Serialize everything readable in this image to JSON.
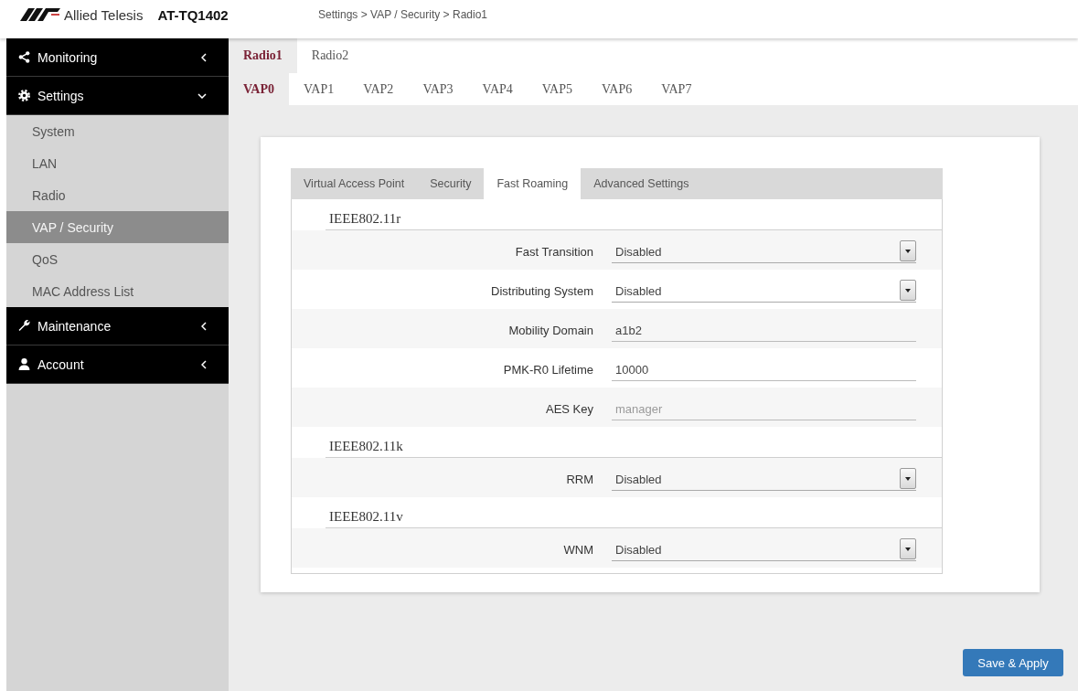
{
  "header": {
    "brand": "Allied Telesis",
    "model": "AT-TQ1402",
    "breadcrumb": "Settings > VAP / Security > Radio1"
  },
  "sidebar": {
    "groups": [
      {
        "label": "Monitoring",
        "expanded": false
      },
      {
        "label": "Settings",
        "expanded": true,
        "children": [
          {
            "label": "System",
            "selected": false
          },
          {
            "label": "LAN",
            "selected": false
          },
          {
            "label": "Radio",
            "selected": false
          },
          {
            "label": "VAP / Security",
            "selected": true
          },
          {
            "label": "QoS",
            "selected": false
          },
          {
            "label": "MAC Address List",
            "selected": false
          }
        ]
      },
      {
        "label": "Maintenance",
        "expanded": false
      },
      {
        "label": "Account",
        "expanded": false
      }
    ]
  },
  "radio_tabs": [
    {
      "label": "Radio1",
      "selected": true
    },
    {
      "label": "Radio2",
      "selected": false
    }
  ],
  "vap_tabs": [
    {
      "label": "VAP0",
      "selected": true
    },
    {
      "label": "VAP1",
      "selected": false
    },
    {
      "label": "VAP2",
      "selected": false
    },
    {
      "label": "VAP3",
      "selected": false
    },
    {
      "label": "VAP4",
      "selected": false
    },
    {
      "label": "VAP5",
      "selected": false
    },
    {
      "label": "VAP6",
      "selected": false
    },
    {
      "label": "VAP7",
      "selected": false
    }
  ],
  "panel": {
    "tabs": [
      {
        "label": "Virtual Access Point",
        "selected": false
      },
      {
        "label": "Security",
        "selected": false
      },
      {
        "label": "Fast Roaming",
        "selected": true
      },
      {
        "label": "Advanced Settings",
        "selected": false
      }
    ],
    "sections": [
      {
        "title": "IEEE802.11r",
        "fields": [
          {
            "kind": "select",
            "label": "Fast Transition",
            "value": "Disabled"
          },
          {
            "kind": "select",
            "label": "Distributing System",
            "value": "Disabled"
          },
          {
            "kind": "text",
            "label": "Mobility Domain",
            "value": "a1b2"
          },
          {
            "kind": "text",
            "label": "PMK-R0 Lifetime",
            "value": "10000"
          },
          {
            "kind": "text",
            "label": "AES Key",
            "placeholder": "manager"
          }
        ]
      },
      {
        "title": "IEEE802.11k",
        "fields": [
          {
            "kind": "select",
            "label": "RRM",
            "value": "Disabled"
          }
        ]
      },
      {
        "title": "IEEE802.11v",
        "fields": [
          {
            "kind": "select",
            "label": "WNM",
            "value": "Disabled"
          }
        ]
      }
    ]
  },
  "save_button": "Save & Apply"
}
